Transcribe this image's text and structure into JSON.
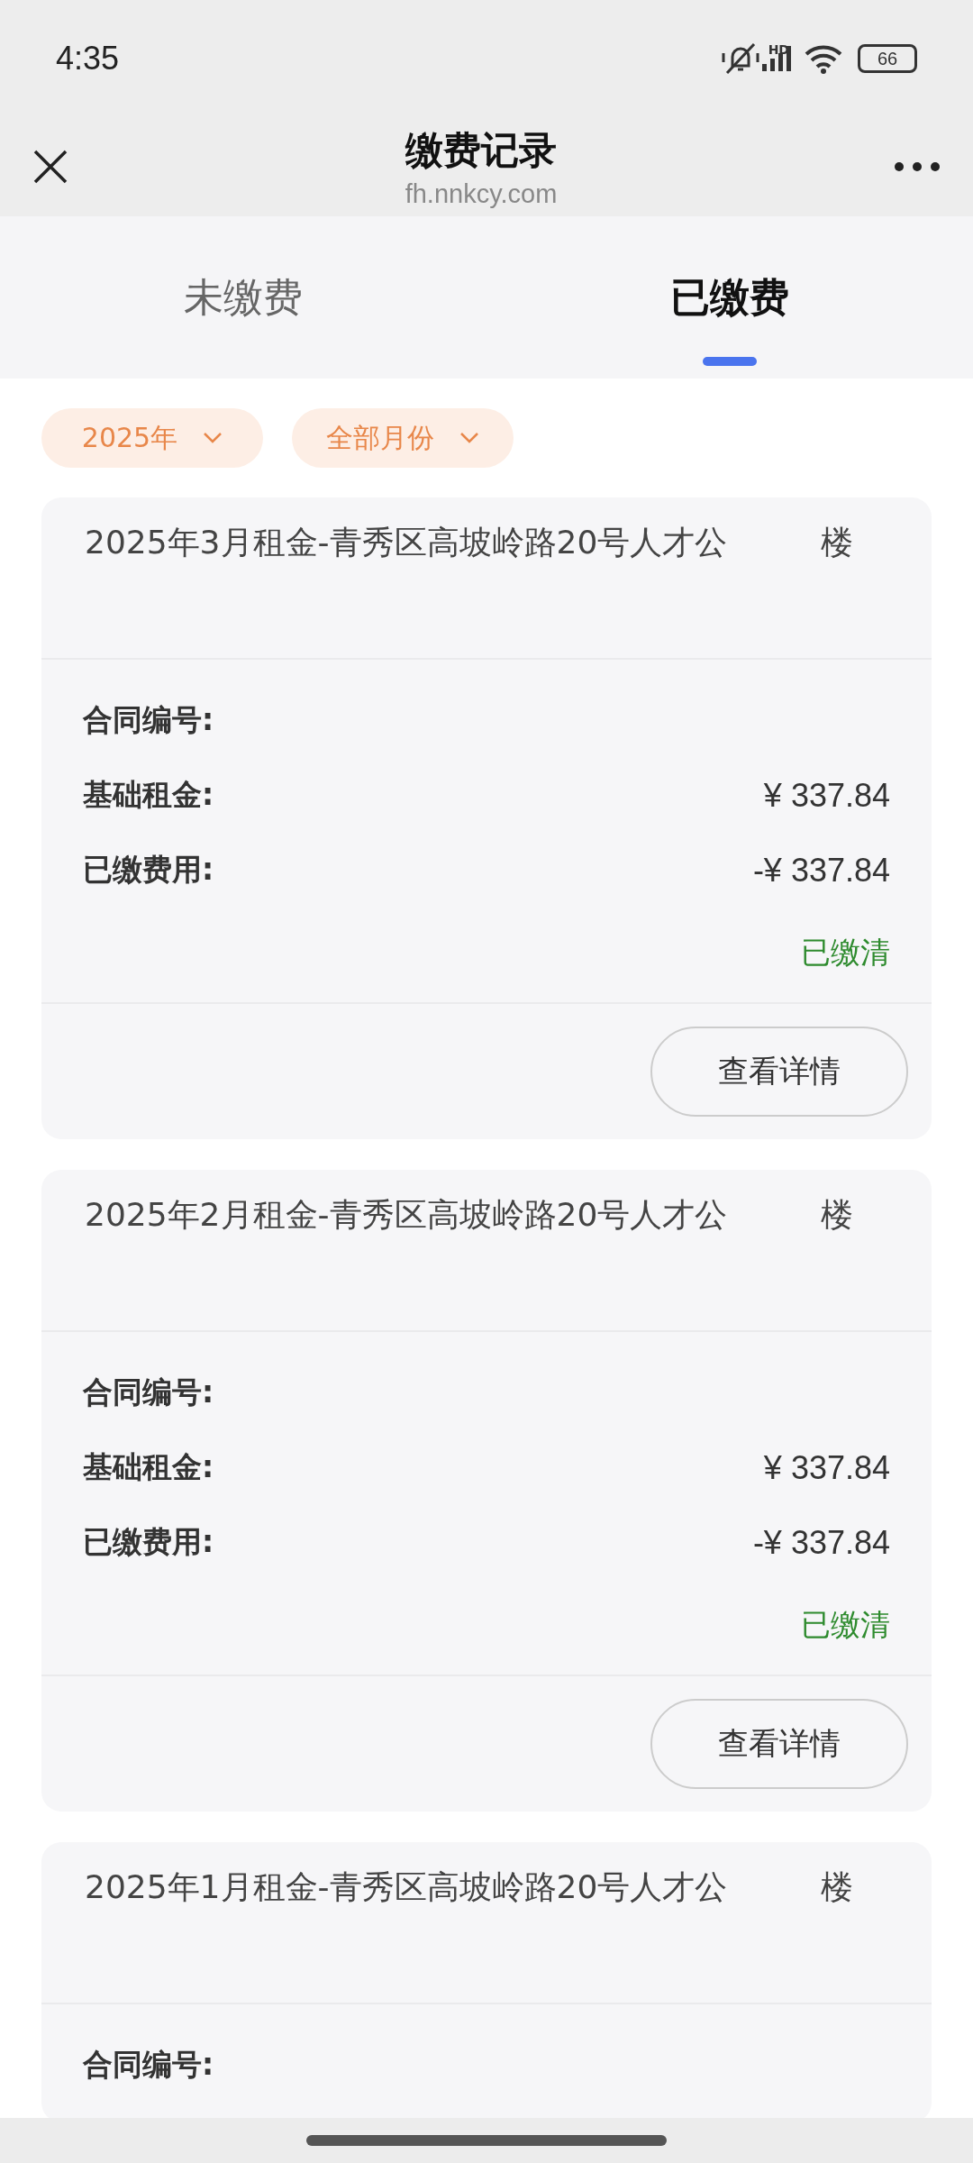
{
  "status_bar": {
    "time": "4:35",
    "network": "HD",
    "battery": "66"
  },
  "header": {
    "title": "缴费记录",
    "url": "fh.nnkcy.com"
  },
  "tabs": [
    {
      "label": "未缴费",
      "selected": false
    },
    {
      "label": "已缴费",
      "selected": true
    }
  ],
  "filters": [
    {
      "label": "2025年"
    },
    {
      "label": "全部月份"
    }
  ],
  "records": [
    {
      "title": "2025年3月租金-青秀区高坡岭路20号人才公",
      "title_end": "楼",
      "rows": [
        {
          "label": "合同编号:"
        },
        {
          "label": "基础租金:",
          "value": "¥ 337.84"
        },
        {
          "label": "已缴费用:",
          "value": "-¥ 337.84"
        }
      ],
      "status": "已缴清",
      "button": "查看详情"
    },
    {
      "title": "2025年2月租金-青秀区高坡岭路20号人才公",
      "title_end": "楼",
      "rows": [
        {
          "label": "合同编号:"
        },
        {
          "label": "基础租金:",
          "value": "¥ 337.84"
        },
        {
          "label": "已缴费用:",
          "value": "-¥ 337.84"
        }
      ],
      "status": "已缴清",
      "button": "查看详情"
    },
    {
      "title": "2025年1月租金-青秀区高坡岭路20号人才公",
      "title_end": "楼",
      "rows": [
        {
          "label": "合同编号:"
        }
      ]
    }
  ]
}
